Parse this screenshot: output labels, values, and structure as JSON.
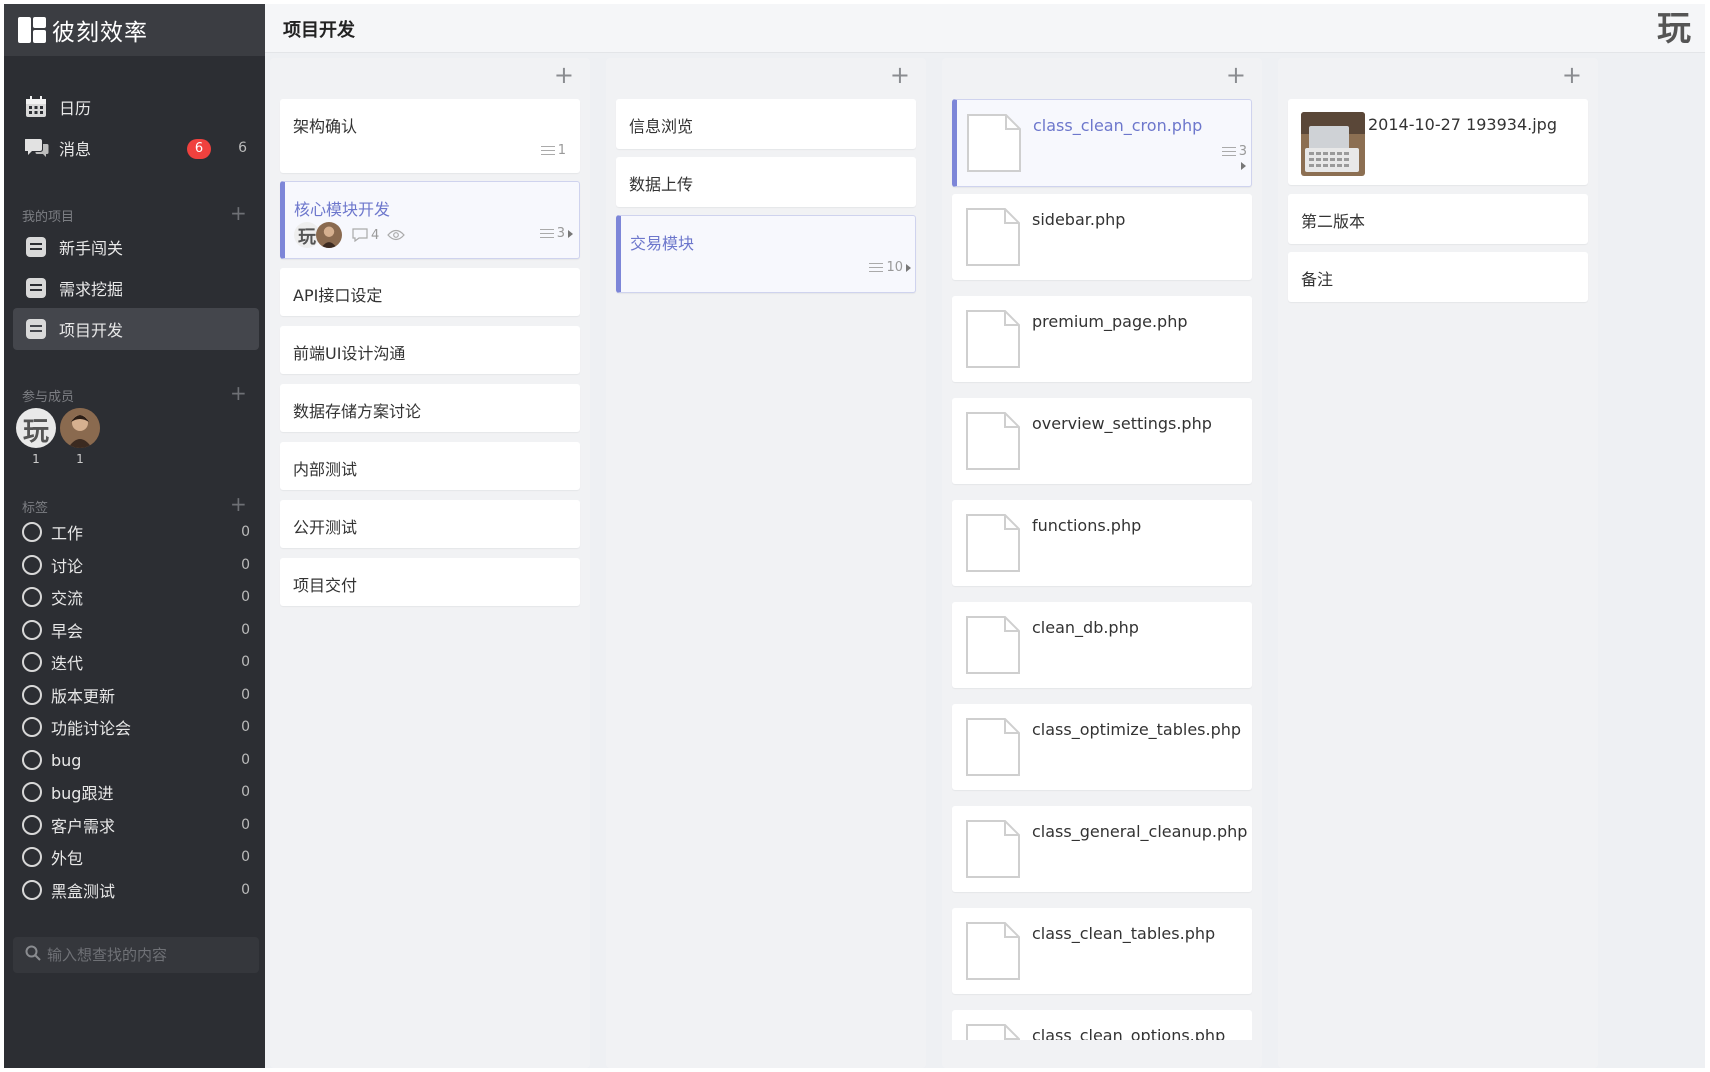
{
  "app": {
    "brand": "彼刻效率",
    "user_logo_glyph": "玩"
  },
  "sidebar": {
    "calendar_label": "日历",
    "messages_label": "消息",
    "messages_badge": "6",
    "messages_count": "6",
    "my_projects_title": "我的项目",
    "projects": [
      {
        "label": "新手闯关"
      },
      {
        "label": "需求挖掘"
      },
      {
        "label": "项目开发"
      }
    ],
    "members_title": "参与成员",
    "members": [
      {
        "count": "1",
        "initial": "玩"
      },
      {
        "count": "1"
      }
    ],
    "tags_title": "标签",
    "tags": [
      {
        "label": "工作",
        "count": "0"
      },
      {
        "label": "讨论",
        "count": "0"
      },
      {
        "label": "交流",
        "count": "0"
      },
      {
        "label": "早会",
        "count": "0"
      },
      {
        "label": "迭代",
        "count": "0"
      },
      {
        "label": "版本更新",
        "count": "0"
      },
      {
        "label": "功能讨论会",
        "count": "0"
      },
      {
        "label": "bug",
        "count": "0"
      },
      {
        "label": "bug跟进",
        "count": "0"
      },
      {
        "label": "客户需求",
        "count": "0"
      },
      {
        "label": "外包",
        "count": "0"
      },
      {
        "label": "黑盒测试",
        "count": "0"
      }
    ],
    "search_placeholder": "输入想查找的内容"
  },
  "header": {
    "title": "项目开发"
  },
  "columns": [
    {
      "add_glyph": "+",
      "cards": [
        {
          "title": "架构确认",
          "subtasks": "1"
        },
        {
          "title": "核心模块开发",
          "subtasks": "3",
          "comments": "4",
          "avatar_initial": "玩",
          "selected": true
        },
        {
          "title": "API接口设定"
        },
        {
          "title": "前端UI设计沟通"
        },
        {
          "title": "数据存储方案讨论"
        },
        {
          "title": "内部测试"
        },
        {
          "title": "公开测试"
        },
        {
          "title": "项目交付"
        }
      ]
    },
    {
      "add_glyph": "+",
      "cards": [
        {
          "title": "信息浏览"
        },
        {
          "title": "数据上传"
        },
        {
          "title": "交易模块",
          "subtasks": "10",
          "selected": true
        }
      ]
    },
    {
      "add_glyph": "+",
      "cards": [
        {
          "title": "class_clean_cron.php",
          "subtasks": "3",
          "selected": true
        },
        {
          "title": "sidebar.php"
        },
        {
          "title": "premium_page.php"
        },
        {
          "title": "overview_settings.php"
        },
        {
          "title": "functions.php"
        },
        {
          "title": "clean_db.php"
        },
        {
          "title": "class_optimize_tables.php"
        },
        {
          "title": "class_general_cleanup.php"
        },
        {
          "title": "class_clean_tables.php"
        },
        {
          "title": "class_clean_options.php"
        }
      ]
    },
    {
      "add_glyph": "+",
      "cards": [
        {
          "title": "2014-10-27 193934.jpg"
        },
        {
          "title": "第二版本"
        },
        {
          "title": "备注"
        }
      ]
    }
  ],
  "colors": {
    "sidebar_bg": "#2c2e33",
    "accent": "#7d86d8",
    "badge": "#f0413e"
  }
}
